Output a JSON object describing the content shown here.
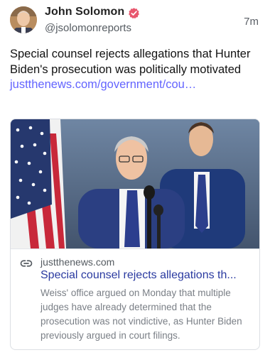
{
  "post": {
    "author": {
      "display_name": "John Solomon",
      "handle": "@jsolomonreports",
      "verified_icon": "verified-badge-icon",
      "verified_color": "#e8576e"
    },
    "timestamp": "7m",
    "text_before_link": "Special counsel rejects allegations that Hunter Biden's prosecution was politically motivated ",
    "link_text": "justthenews.com/government/cou…",
    "link_color": "#6364ff"
  },
  "card": {
    "domain": "justthenews.com",
    "title": "Special counsel rejects allegations th...",
    "description": "Weiss' office argued on Monday that multiple judges have already determined that the prosecution was not vindictive, as Hunter Biden previously argued in court filings.",
    "link_icon": "link-icon",
    "title_color": "#2a3aa0"
  }
}
